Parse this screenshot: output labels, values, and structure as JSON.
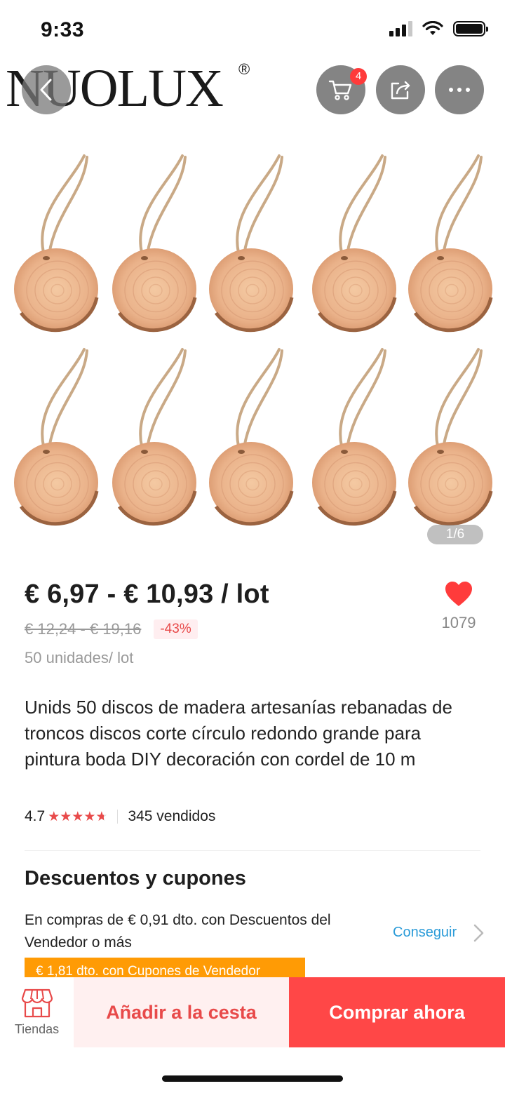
{
  "status": {
    "time": "9:33"
  },
  "header": {
    "brand": "NUOLUX",
    "brand_mark": "®",
    "cart_count": "4"
  },
  "gallery": {
    "counter": "1/6"
  },
  "price": {
    "main": "€ 6,97 - € 10,93 / lot",
    "old": "€ 12,24 - € 19,16",
    "discount": "-43%",
    "unit": "50 unidades/ lot"
  },
  "wishlist": {
    "count": "1079"
  },
  "product": {
    "title": "Unids 50 discos de madera artesanías rebanadas de troncos discos corte círculo redondo grande para pintura boda DIY decoración con cordel de 10 m",
    "rating": "4.7",
    "rating_value": 4.7,
    "sold": "345 vendidos"
  },
  "coupons": {
    "heading": "Descuentos y cupones",
    "text": "En compras de € 0,91 dto. con Descuentos del Vendedor o más",
    "link": "Conseguir",
    "tag": "€ 1,81 dto. con Cupones de Vendedor"
  },
  "bottom": {
    "shops": "Tiendas",
    "add_to_cart": "Añadir a la cesta",
    "buy_now": "Comprar ahora"
  },
  "colors": {
    "accent": "#ff4747",
    "accent_light": "#fff0f0",
    "link": "#2a9bd8",
    "coupon": "#ff9b05"
  }
}
